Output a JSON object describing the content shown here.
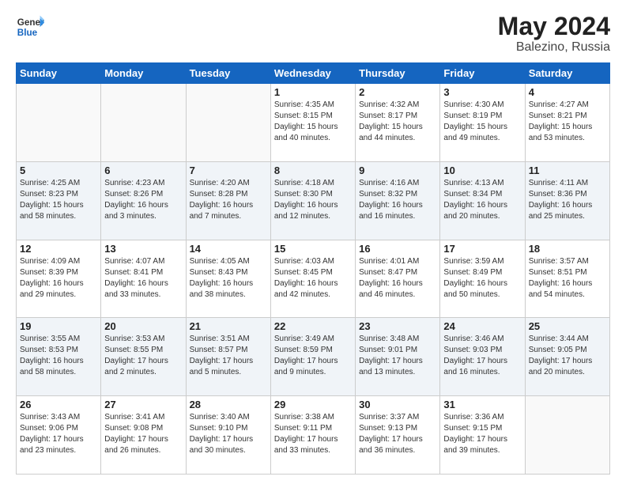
{
  "header": {
    "logo_line1": "General",
    "logo_line2": "Blue",
    "month_year": "May 2024",
    "location": "Balezino, Russia"
  },
  "weekdays": [
    "Sunday",
    "Monday",
    "Tuesday",
    "Wednesday",
    "Thursday",
    "Friday",
    "Saturday"
  ],
  "weeks": [
    [
      {
        "day": "",
        "info": ""
      },
      {
        "day": "",
        "info": ""
      },
      {
        "day": "",
        "info": ""
      },
      {
        "day": "1",
        "info": "Sunrise: 4:35 AM\nSunset: 8:15 PM\nDaylight: 15 hours\nand 40 minutes."
      },
      {
        "day": "2",
        "info": "Sunrise: 4:32 AM\nSunset: 8:17 PM\nDaylight: 15 hours\nand 44 minutes."
      },
      {
        "day": "3",
        "info": "Sunrise: 4:30 AM\nSunset: 8:19 PM\nDaylight: 15 hours\nand 49 minutes."
      },
      {
        "day": "4",
        "info": "Sunrise: 4:27 AM\nSunset: 8:21 PM\nDaylight: 15 hours\nand 53 minutes."
      }
    ],
    [
      {
        "day": "5",
        "info": "Sunrise: 4:25 AM\nSunset: 8:23 PM\nDaylight: 15 hours\nand 58 minutes."
      },
      {
        "day": "6",
        "info": "Sunrise: 4:23 AM\nSunset: 8:26 PM\nDaylight: 16 hours\nand 3 minutes."
      },
      {
        "day": "7",
        "info": "Sunrise: 4:20 AM\nSunset: 8:28 PM\nDaylight: 16 hours\nand 7 minutes."
      },
      {
        "day": "8",
        "info": "Sunrise: 4:18 AM\nSunset: 8:30 PM\nDaylight: 16 hours\nand 12 minutes."
      },
      {
        "day": "9",
        "info": "Sunrise: 4:16 AM\nSunset: 8:32 PM\nDaylight: 16 hours\nand 16 minutes."
      },
      {
        "day": "10",
        "info": "Sunrise: 4:13 AM\nSunset: 8:34 PM\nDaylight: 16 hours\nand 20 minutes."
      },
      {
        "day": "11",
        "info": "Sunrise: 4:11 AM\nSunset: 8:36 PM\nDaylight: 16 hours\nand 25 minutes."
      }
    ],
    [
      {
        "day": "12",
        "info": "Sunrise: 4:09 AM\nSunset: 8:39 PM\nDaylight: 16 hours\nand 29 minutes."
      },
      {
        "day": "13",
        "info": "Sunrise: 4:07 AM\nSunset: 8:41 PM\nDaylight: 16 hours\nand 33 minutes."
      },
      {
        "day": "14",
        "info": "Sunrise: 4:05 AM\nSunset: 8:43 PM\nDaylight: 16 hours\nand 38 minutes."
      },
      {
        "day": "15",
        "info": "Sunrise: 4:03 AM\nSunset: 8:45 PM\nDaylight: 16 hours\nand 42 minutes."
      },
      {
        "day": "16",
        "info": "Sunrise: 4:01 AM\nSunset: 8:47 PM\nDaylight: 16 hours\nand 46 minutes."
      },
      {
        "day": "17",
        "info": "Sunrise: 3:59 AM\nSunset: 8:49 PM\nDaylight: 16 hours\nand 50 minutes."
      },
      {
        "day": "18",
        "info": "Sunrise: 3:57 AM\nSunset: 8:51 PM\nDaylight: 16 hours\nand 54 minutes."
      }
    ],
    [
      {
        "day": "19",
        "info": "Sunrise: 3:55 AM\nSunset: 8:53 PM\nDaylight: 16 hours\nand 58 minutes."
      },
      {
        "day": "20",
        "info": "Sunrise: 3:53 AM\nSunset: 8:55 PM\nDaylight: 17 hours\nand 2 minutes."
      },
      {
        "day": "21",
        "info": "Sunrise: 3:51 AM\nSunset: 8:57 PM\nDaylight: 17 hours\nand 5 minutes."
      },
      {
        "day": "22",
        "info": "Sunrise: 3:49 AM\nSunset: 8:59 PM\nDaylight: 17 hours\nand 9 minutes."
      },
      {
        "day": "23",
        "info": "Sunrise: 3:48 AM\nSunset: 9:01 PM\nDaylight: 17 hours\nand 13 minutes."
      },
      {
        "day": "24",
        "info": "Sunrise: 3:46 AM\nSunset: 9:03 PM\nDaylight: 17 hours\nand 16 minutes."
      },
      {
        "day": "25",
        "info": "Sunrise: 3:44 AM\nSunset: 9:05 PM\nDaylight: 17 hours\nand 20 minutes."
      }
    ],
    [
      {
        "day": "26",
        "info": "Sunrise: 3:43 AM\nSunset: 9:06 PM\nDaylight: 17 hours\nand 23 minutes."
      },
      {
        "day": "27",
        "info": "Sunrise: 3:41 AM\nSunset: 9:08 PM\nDaylight: 17 hours\nand 26 minutes."
      },
      {
        "day": "28",
        "info": "Sunrise: 3:40 AM\nSunset: 9:10 PM\nDaylight: 17 hours\nand 30 minutes."
      },
      {
        "day": "29",
        "info": "Sunrise: 3:38 AM\nSunset: 9:11 PM\nDaylight: 17 hours\nand 33 minutes."
      },
      {
        "day": "30",
        "info": "Sunrise: 3:37 AM\nSunset: 9:13 PM\nDaylight: 17 hours\nand 36 minutes."
      },
      {
        "day": "31",
        "info": "Sunrise: 3:36 AM\nSunset: 9:15 PM\nDaylight: 17 hours\nand 39 minutes."
      },
      {
        "day": "",
        "info": ""
      }
    ]
  ]
}
